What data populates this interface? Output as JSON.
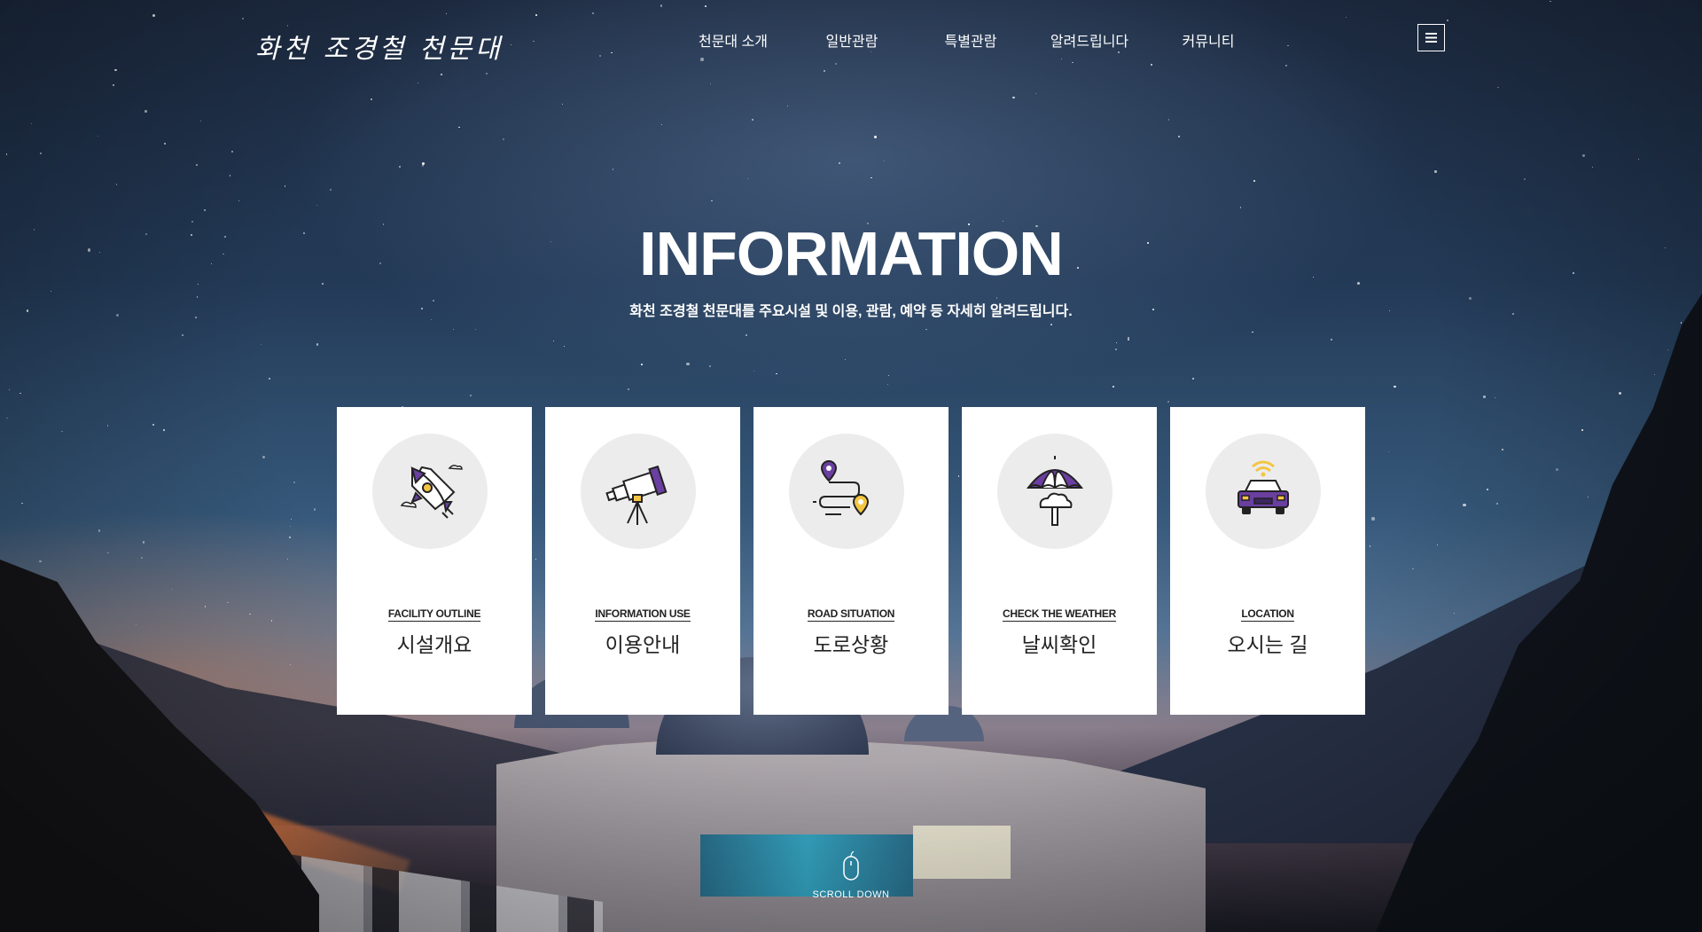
{
  "header": {
    "logo_text": "화천 조경철 천문대",
    "nav": [
      {
        "label": "천문대 소개"
      },
      {
        "label": "일반관람"
      },
      {
        "label": "특별관람"
      },
      {
        "label": "알려드립니다"
      },
      {
        "label": "커뮤니티"
      }
    ],
    "menu_icon": "hamburger-menu-icon"
  },
  "hero": {
    "title": "INFORMATION",
    "subtitle": "화천 조경철 천문대를 주요시설 및 이용, 관람, 예약 등 자세히 알려드립니다."
  },
  "cards": [
    {
      "en": "FACILITY OUTLINE",
      "ko": "시설개요",
      "icon": "rocket-icon"
    },
    {
      "en": "INFORMATION USE",
      "ko": "이용안내",
      "icon": "telescope-icon"
    },
    {
      "en": "ROAD SITUATION",
      "ko": "도로상황",
      "icon": "route-map-icon"
    },
    {
      "en": "CHECK THE WEATHER",
      "ko": "날씨확인",
      "icon": "umbrella-weather-icon"
    },
    {
      "en": "LOCATION",
      "ko": "오시는 길",
      "icon": "car-wifi-icon"
    }
  ],
  "scroll": {
    "label": "SCROLL DOWN",
    "icon": "mouse-icon"
  },
  "colors": {
    "accent_purple": "#6a3fa0",
    "icon_yellow": "#f4c542",
    "card_bg": "#ffffff",
    "icon_circle": "#ececec"
  }
}
